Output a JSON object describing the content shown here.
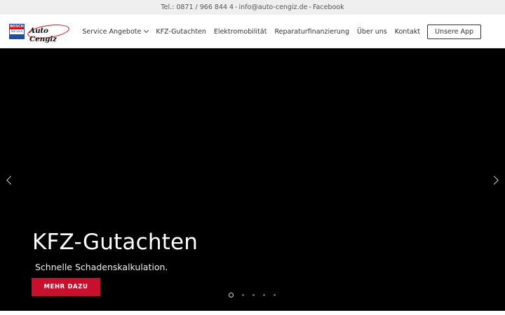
{
  "topbar": {
    "phone": "Tel.: 0871 / 966 844 4",
    "sep1": "-",
    "email": "info@auto-cengiz.de",
    "sep2": "-",
    "facebook": "Facebook"
  },
  "logo": {
    "bosch_line1": "BOSCH",
    "bosch_line2": "Service",
    "wordmark": "Auto Cengiz"
  },
  "nav": {
    "items": [
      {
        "label": "Service Angebote",
        "has_dropdown": true
      },
      {
        "label": "KFZ-Gutachten"
      },
      {
        "label": "Elektromobilität"
      },
      {
        "label": "Reparaturfinanzierung"
      },
      {
        "label": "Über uns"
      },
      {
        "label": "Kontakt"
      }
    ],
    "app_button": "Unsere App"
  },
  "hero": {
    "title": "KFZ-Gutachten",
    "subtitle": "Schnelle Schadenskalkulation.",
    "cta": "MEHR DAZU",
    "slides_total": 5,
    "active_slide": 1
  },
  "colors": {
    "accent": "#c8102e",
    "hero_bg": "#000000",
    "topbar_bg": "#efefef"
  },
  "icons": {
    "prev": "chevron-left-icon",
    "next": "chevron-right-icon",
    "dropdown": "chevron-down-icon"
  }
}
